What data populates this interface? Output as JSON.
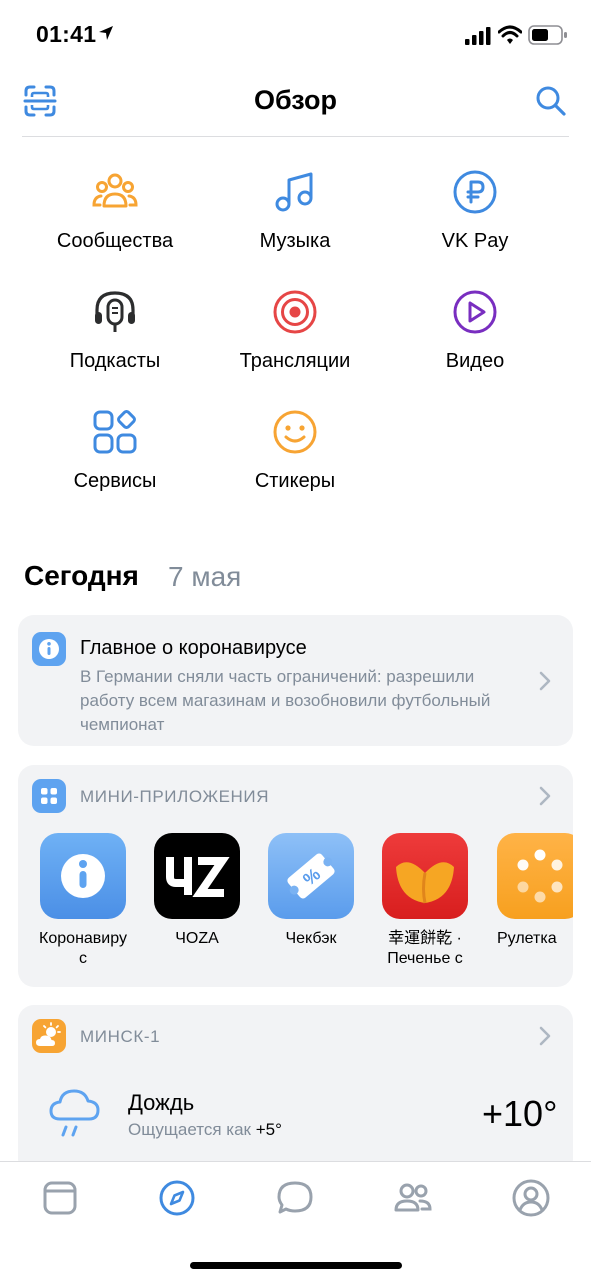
{
  "status": {
    "time": "01:41"
  },
  "header": {
    "title": "Обзор"
  },
  "grid": [
    {
      "label": "Сообщества",
      "icon": "communities-icon",
      "color": "#f7a433"
    },
    {
      "label": "Музыка",
      "icon": "music-icon",
      "color": "#3f8ae0"
    },
    {
      "label": "VK Pay",
      "icon": "vkpay-icon",
      "color": "#3f8ae0"
    },
    {
      "label": "Подкасты",
      "icon": "podcasts-icon",
      "color": "#2c2d2e"
    },
    {
      "label": "Трансляции",
      "icon": "broadcasts-icon",
      "color": "#e64646"
    },
    {
      "label": "Видео",
      "icon": "video-icon",
      "color": "#792ec0"
    },
    {
      "label": "Сервисы",
      "icon": "services-icon",
      "color": "#3f8ae0"
    },
    {
      "label": "Стикеры",
      "icon": "stickers-icon",
      "color": "#f7a433"
    }
  ],
  "today": {
    "title": "Сегодня",
    "date": "7 мая"
  },
  "news": {
    "title": "Главное о коронавирусе",
    "text": "В Германии сняли часть ограничений: разрешили работу всем магазинам и возобновили футбольный чемпионат"
  },
  "mini_apps": {
    "title": "МИНИ-ПРИЛОЖЕНИЯ",
    "items": [
      {
        "label": "Коронавиру с",
        "icon": "info-icon"
      },
      {
        "label": "ЧОZA",
        "icon": "choza-logo"
      },
      {
        "label": "Чекбэк",
        "icon": "ticket-percent-icon"
      },
      {
        "label": "幸運餅乾 · Печенье с",
        "icon": "fortune-cookie-icon"
      },
      {
        "label": "Рулетка",
        "icon": "roulette-icon"
      }
    ]
  },
  "weather": {
    "city": "МИНСК-1",
    "condition": "Дождь",
    "feels_like_label": "Ощущается как",
    "feels_like_value": "+5°",
    "temperature": "+10°"
  },
  "tabs": [
    {
      "name": "tab-news",
      "icon": "newsfeed-icon"
    },
    {
      "name": "tab-discover",
      "icon": "compass-icon",
      "active": true
    },
    {
      "name": "tab-messages",
      "icon": "message-icon"
    },
    {
      "name": "tab-friends",
      "icon": "friends-icon"
    },
    {
      "name": "tab-profile",
      "icon": "profile-icon"
    }
  ],
  "colors": {
    "accent": "#3f8ae0",
    "secondary_text": "#818c99",
    "card_bg": "#f2f3f5"
  }
}
